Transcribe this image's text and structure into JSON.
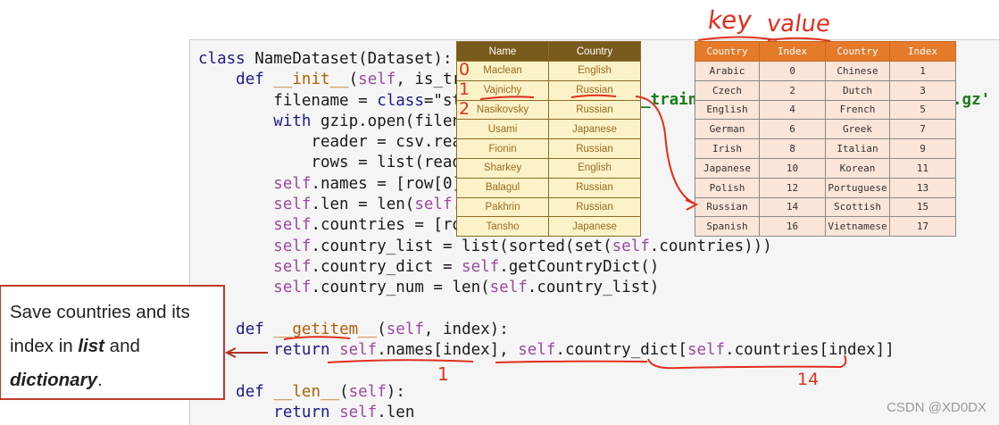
{
  "code": {
    "lines": [
      "class NameDataset(Dataset):",
      "    def __init__(self, is_trai",
      "        filename = 'data/names",
      "        with gzip.open(filenam",
      "            reader = csv.reade",
      "            rows = list(reader",
      "        self.names = [row[0] f",
      "        self.len = len(self.na",
      "        self.countries = [row[",
      "        self.country_list = list(sorted(set(self.countries)))",
      "        self.country_dict = self.getCountryDict()",
      "        self.country_num = len(self.country_list)",
      "",
      "    def __getitem__(self, index):",
      "        return self.names[index], self.country_dict[self.countries[index]]",
      "",
      "    def __len__(self):",
      "        return self.len"
    ],
    "overflow_fragments": {
      "train": "_train_",
      "gz": ".gz'"
    }
  },
  "names_table": {
    "headers": [
      "Name",
      "Country"
    ],
    "rows": [
      [
        "Maclean",
        "English"
      ],
      [
        "Vajnichy",
        "Russian"
      ],
      [
        "Nasikovsky",
        "Russian"
      ],
      [
        "Usami",
        "Japanese"
      ],
      [
        "Fionin",
        "Russian"
      ],
      [
        "Sharkey",
        "English"
      ],
      [
        "Balagul",
        "Russian"
      ],
      [
        "Pakhrin",
        "Russian"
      ],
      [
        "Tansho",
        "Japanese"
      ]
    ],
    "row_indices": [
      "0",
      "1",
      "2"
    ]
  },
  "country_table": {
    "headers": [
      "Country",
      "Index",
      "Country",
      "Index"
    ],
    "rows": [
      [
        "Arabic",
        "0",
        "Chinese",
        "1"
      ],
      [
        "Czech",
        "2",
        "Dutch",
        "3"
      ],
      [
        "English",
        "4",
        "French",
        "5"
      ],
      [
        "German",
        "6",
        "Greek",
        "7"
      ],
      [
        "Irish",
        "8",
        "Italian",
        "9"
      ],
      [
        "Japanese",
        "10",
        "Korean",
        "11"
      ],
      [
        "Polish",
        "12",
        "Portuguese",
        "13"
      ],
      [
        "Russian",
        "14",
        "Scottish",
        "15"
      ],
      [
        "Spanish",
        "16",
        "Vietnamese",
        "17"
      ]
    ]
  },
  "annotations": {
    "key_label": "key",
    "value_label": "value",
    "under_names": "1",
    "under_dict": "14"
  },
  "note": {
    "line1": "Save countries and its",
    "line2_pre": "index in ",
    "line2_em": "list",
    "line2_post": " and",
    "line3_em": "dictionary",
    "line3_post": "."
  },
  "watermark": "CSDN @XD0DX",
  "colors": {
    "annotation": "#e0301e",
    "names_header": "#7a5a1c",
    "country_header": "#e47a2a"
  }
}
